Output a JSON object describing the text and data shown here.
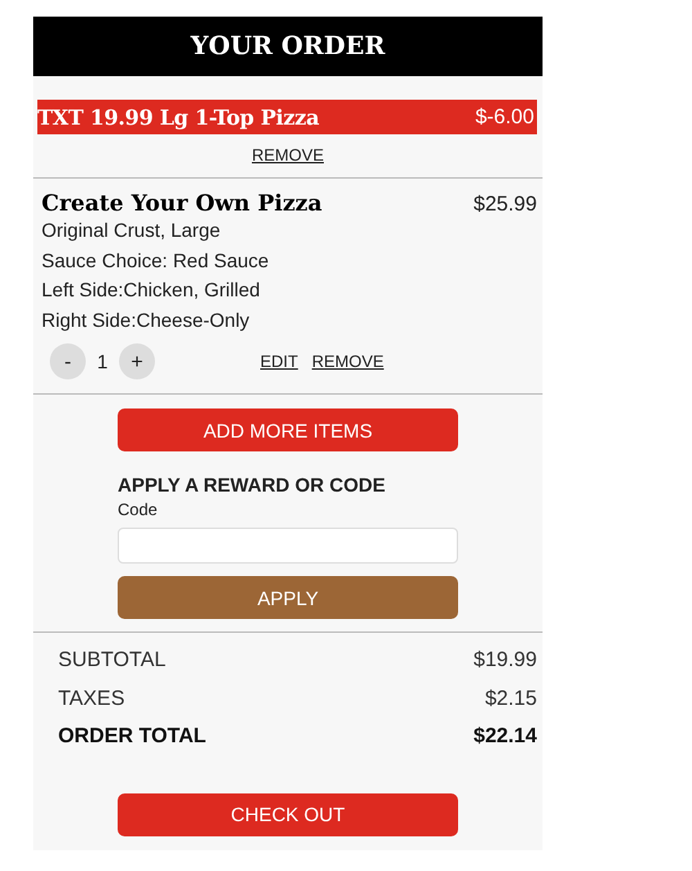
{
  "header": {
    "title": "YOUR ORDER"
  },
  "coupon": {
    "name": "TXT 19.99 Lg 1-Top Pizza",
    "amount": "$-6.00",
    "remove": "REMOVE"
  },
  "items": [
    {
      "name": "Create Your Own Pizza",
      "price": "$25.99",
      "details": [
        "Original Crust, Large",
        "Sauce Choice: Red Sauce",
        "Left Side:Chicken, Grilled",
        "Right Side:Cheese-Only"
      ],
      "decrease": "-",
      "quantity": "1",
      "increase": "+",
      "edit": "EDIT",
      "remove": "REMOVE"
    }
  ],
  "add_more": "ADD MORE ITEMS",
  "reward": {
    "heading": "APPLY A REWARD OR CODE",
    "label": "Code",
    "apply": "APPLY"
  },
  "totals": [
    {
      "label": "SUBTOTAL",
      "value": "$19.99",
      "bold": false
    },
    {
      "label": "TAXES",
      "value": "$2.15",
      "bold": false
    },
    {
      "label": "ORDER TOTAL",
      "value": "$22.14",
      "bold": true
    }
  ],
  "checkout": "CHECK OUT"
}
